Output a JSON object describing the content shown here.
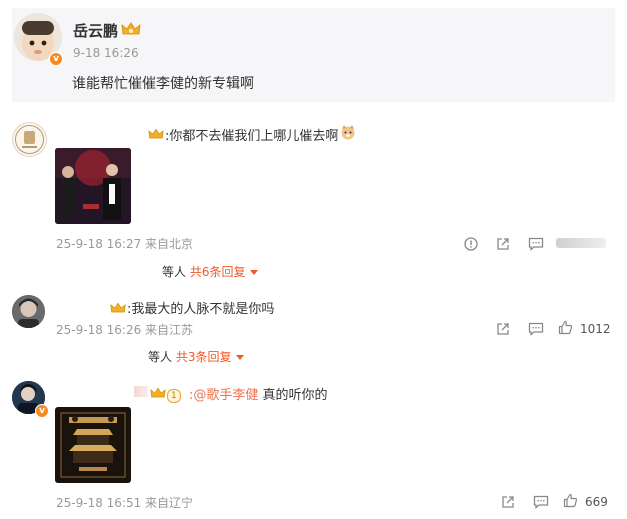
{
  "post": {
    "author": "岳云鹏",
    "time": "9-18 16:26",
    "text": "谁能帮忙催催李健的新专辑啊",
    "verified_badge": "v"
  },
  "comments": [
    {
      "text": ":你都不去催我们上哪儿催去啊",
      "time": "25-9-18 16:27 来自北京",
      "reply": {
        "prefix": "等人",
        "count": "共6条回复"
      }
    },
    {
      "text": ":我最大的人脉不就是你吗",
      "time": "25-9-18 16:26 来自江苏",
      "likes": "1012",
      "reply": {
        "prefix": "等人",
        "count": "共3条回复"
      }
    },
    {
      "level": "1",
      "mention": ":@歌手李健",
      "text": " 真的听你的",
      "time": "25-9-18 16:51 来自辽宁",
      "likes": "669"
    }
  ],
  "colors": {
    "accent": "#f05a28",
    "mention": "#eb7350",
    "post_bg": "#f6f6f8",
    "meta": "#999999"
  }
}
